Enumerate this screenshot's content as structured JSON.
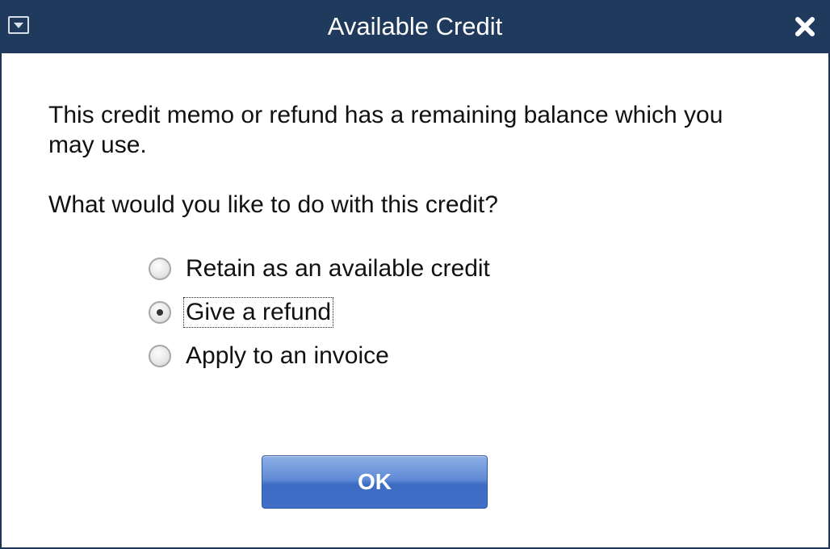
{
  "window": {
    "title": "Available Credit"
  },
  "titlebar": {
    "menu_icon": "dropdown-menu-icon",
    "close_icon": "close-icon"
  },
  "dialog": {
    "message": "This credit memo or refund has a remaining balance which you may use.",
    "question": "What would you like to do with this credit?",
    "options": [
      {
        "label": "Retain as an available credit",
        "selected": false
      },
      {
        "label": "Give a refund",
        "selected": true
      },
      {
        "label": "Apply to an invoice",
        "selected": false
      }
    ],
    "ok_label": "OK"
  },
  "colors": {
    "titlebar": "#1f3a5c",
    "button": "#4a78cc"
  }
}
